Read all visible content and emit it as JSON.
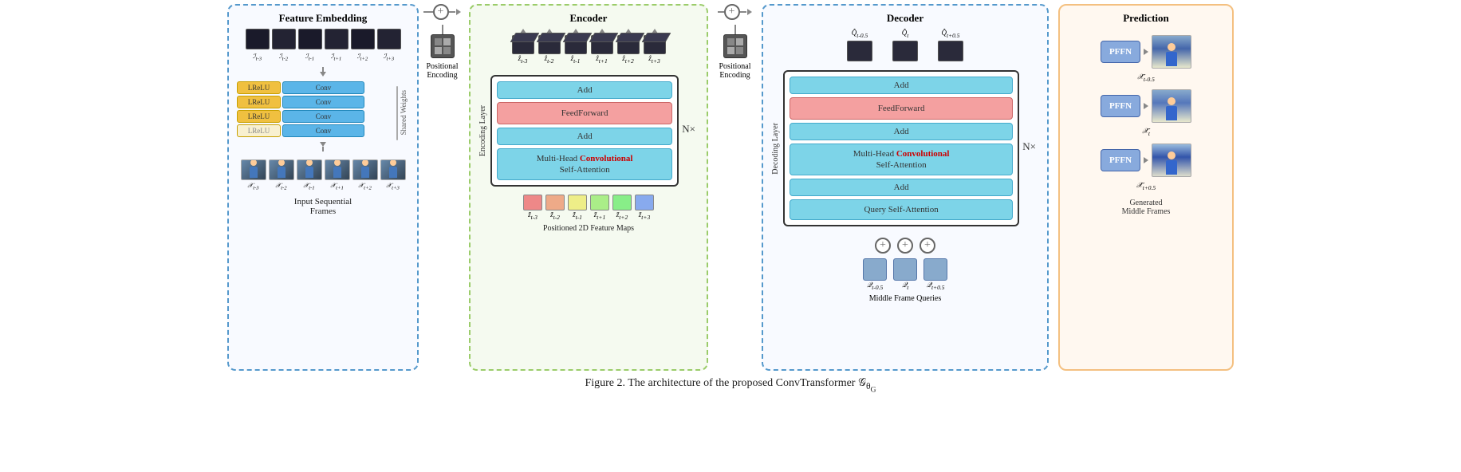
{
  "figure": {
    "caption": "Figure 2.   The architecture of the proposed ConvTransformer ",
    "caption_math": "𝒢_θ_G",
    "sections": {
      "feature_embedding": {
        "title": "Feature Embedding",
        "conv_layers": [
          {
            "lrelu": "LReLU",
            "conv": "Conv"
          },
          {
            "lrelu": "LReLU",
            "conv": "Conv"
          },
          {
            "lrelu": "LReLU",
            "conv": "Conv"
          },
          {
            "lrelu": "LReLU",
            "conv": "Conv"
          }
        ],
        "shared_weights": "Shared Weights",
        "input_labels": [
          "𝒳_{t-3}",
          "𝒳_{t-2}",
          "𝒳_{t-1}",
          "𝒳_{t+1}",
          "𝒳_{t+2}",
          "𝒳_{t+3}"
        ],
        "bottom_label": "Input Sequential\nFrames"
      },
      "pos_encoding_1": {
        "symbol": "+",
        "label": "Positional\nEncoding"
      },
      "encoder": {
        "title": "Encoder",
        "top_cube_labels": [
          "ẑ_{t-3}",
          "ẑ_{t-2}",
          "ẑ_{t-1}",
          "ẑ_{t+1}",
          "ẑ_{t+2}",
          "ẑ_{t+3}"
        ],
        "layers": {
          "label": "Encoding Layer",
          "add_1": "Add",
          "feedforward": "FeedForward",
          "add_2": "Add",
          "multi_head": "Multi-Head",
          "convolutional": "Convolutional",
          "self_attention": "Self-Attention"
        },
        "nx": "N×",
        "bottom_cube_labels": [
          "z̃_{t-3}",
          "z̃_{t-2}",
          "z̃_{t-1}",
          "z̃_{t+1}",
          "z̃_{t+2}",
          "z̃_{t+3}"
        ],
        "bottom_label": "Positioned 2D Feature Maps"
      },
      "pos_encoding_2": {
        "symbol": "+",
        "label": "Positional\nEncoding"
      },
      "decoder": {
        "title": "Decoder",
        "top_cube_labels": [
          "Q̂_{t-0.5}",
          "Q̂_t",
          "Q̂_{t+0.5}"
        ],
        "layers": {
          "label": "Decoding Layer",
          "add_3": "Add",
          "feedforward": "FeedForward",
          "add_2": "Add",
          "multi_head": "Multi-Head",
          "convolutional": "Convolutional",
          "self_attention": "Self-Attention",
          "add_1": "Add",
          "query_sa": "Query Self-Attention"
        },
        "nx": "N×",
        "bottom_query_labels": [
          "Q_{t-0.5}",
          "Q_t",
          "Q_{t+0.5}"
        ],
        "bottom_label": "Middle Frame Queries"
      },
      "prediction": {
        "title": "Prediction",
        "pffn_boxes": [
          "PFFN",
          "PFFN",
          "PFFN"
        ],
        "result_labels": [
          "𝒳̂_{t-0.5}",
          "𝒳̂_t",
          "𝒳̂_{t+0.5}"
        ],
        "bottom_label": "Generated\nMiddle Frames"
      }
    }
  }
}
